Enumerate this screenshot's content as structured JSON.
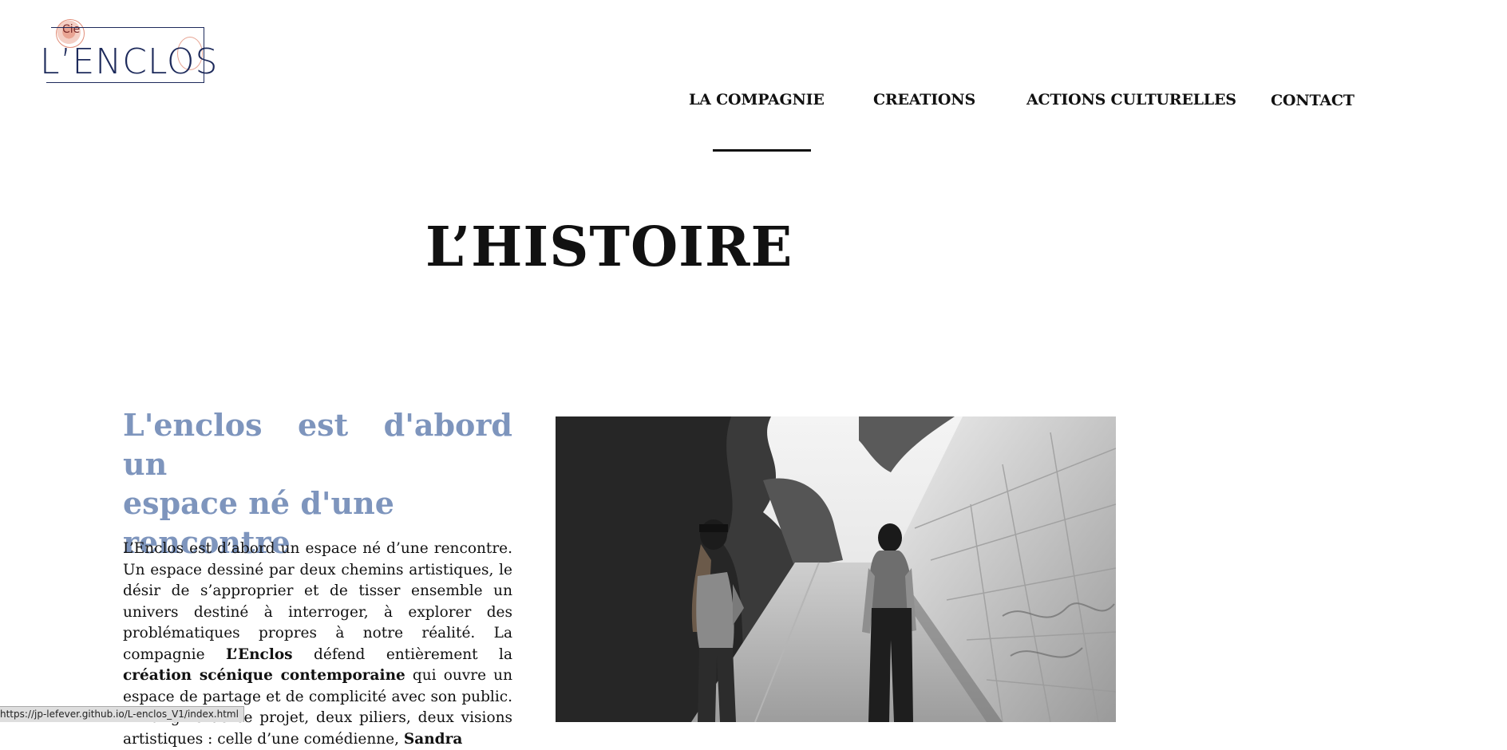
{
  "logo": {
    "cie": "Cie",
    "brand": "L’ENCLOS"
  },
  "nav": {
    "items": [
      {
        "label": "LA COMPAGNIE",
        "active": true
      },
      {
        "label": "CREATIONS"
      },
      {
        "label": "ACTIONS CULTURELLES"
      },
      {
        "label": "CONTACT"
      }
    ]
  },
  "page": {
    "title": "L’HISTOIRE"
  },
  "intro": {
    "heading_lines": [
      "L'enclos est d'abord un",
      "espace né d'une",
      "rencontre"
    ],
    "paragraph": {
      "p1": "L’Enclos est d’abord un espace né d’une rencontre. Un espace dessiné par deux chemins artistiques, le désir de s’approprier et de tisser ensemble un univers destiné à interroger, à explorer des problématiques propres à notre réalité. La compagnie ",
      "b1": "L’Enclos",
      "p2": " défend entièrement la ",
      "b2": "création scénique contemporaine",
      "p3": " qui ouvre un espace de partage et de complicité avec son public. A l’origine de ce projet, deux piliers, deux visions artistiques : celle d’une comédienne, ",
      "b3": "Sandra"
    }
  },
  "status_bar": {
    "url": "https://jp-lefever.github.io/L-enclos_V1/index.html"
  },
  "colors": {
    "accent": "#7e95bd",
    "logo_navy": "#1d2a5b",
    "logo_coral": "#e18d78"
  }
}
